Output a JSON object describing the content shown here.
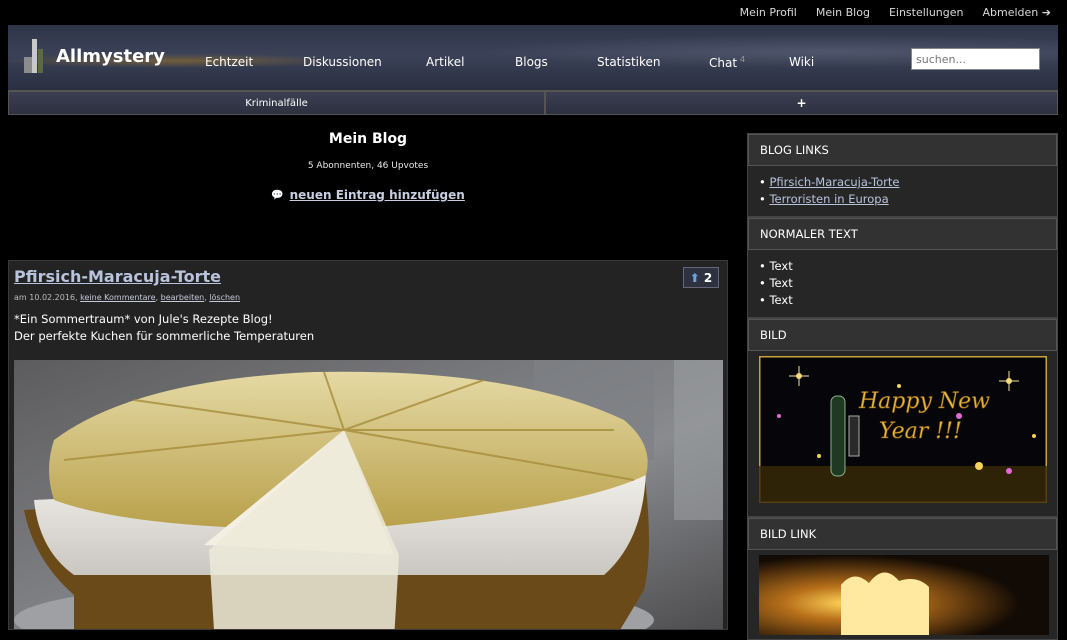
{
  "userbar": {
    "items": [
      "Mein Profil",
      "Mein Blog",
      "Einstellungen",
      "Abmelden ➔"
    ]
  },
  "brand": {
    "name": "Allmystery"
  },
  "nav": {
    "items": [
      "Echtzeit",
      "Diskussionen",
      "Artikel",
      "Blogs",
      "Statistiken",
      "Chat",
      "Wiki"
    ],
    "chat_badge": "4"
  },
  "search": {
    "placeholder": "suchen..."
  },
  "tabs": {
    "first": "Kriminalfälle",
    "add": "+"
  },
  "blog": {
    "title": "Mein Blog",
    "subtitle": "5 Abonnenten, 46 Upvotes",
    "add_entry_label": "neuen Eintrag hinzufügen"
  },
  "post": {
    "title": "Pfirsich-Maracuja-Torte",
    "upvotes": "2",
    "meta_prefix": "am 10.02.2016,",
    "meta_links": [
      "keine Kommentare",
      "bearbeiten",
      "löschen"
    ],
    "body_lines": [
      "*Ein Sommertraum* von Jule's Rezepte Blog!",
      "Der perfekte Kuchen für sommerliche Temperaturen"
    ]
  },
  "sidebar": {
    "blog_links": {
      "title": "BLOG LINKS",
      "items": [
        "Pfirsich-Maracuja-Torte",
        "Terroristen in Europa"
      ]
    },
    "normal_text": {
      "title": "NORMALER TEXT",
      "items": [
        "Text",
        "Text",
        "Text"
      ]
    },
    "bild": {
      "title": "BILD",
      "image_text": [
        "Happy New",
        "Year !!!"
      ]
    },
    "bild_link": {
      "title": "BILD LINK"
    }
  },
  "colors": {
    "accent_link": "#b9c3dc",
    "banner": "#3b4258",
    "upvote_arrow": "#6aa3e0"
  }
}
